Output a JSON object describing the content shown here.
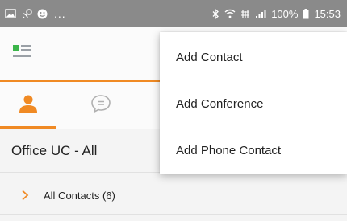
{
  "status_bar": {
    "battery": "100%",
    "time": "15:53",
    "overflow": "..."
  },
  "tabs": [
    {
      "icon": "person-icon",
      "active": true
    },
    {
      "icon": "chat-bubble-icon",
      "active": false
    }
  ],
  "section": {
    "title": "Office UC -  All"
  },
  "groups": [
    {
      "label": "All Contacts (6)",
      "icon": "chevron-right-icon"
    }
  ],
  "menu": {
    "items": [
      {
        "label": "Add Contact"
      },
      {
        "label": "Add Conference"
      },
      {
        "label": "Add Phone Contact"
      }
    ]
  },
  "colors": {
    "accent": "#f08a24",
    "logo_green": "#3bb54a",
    "status_bar": "#8a8a8a"
  }
}
